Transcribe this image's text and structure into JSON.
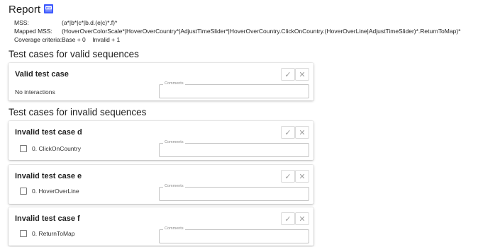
{
  "report": {
    "title": "Report",
    "pdf_icon_label": "PDF"
  },
  "meta": {
    "mss_label": "MSS:",
    "mss_value": "(a*|b*|c*|b.d.(e|c)*.f)*",
    "mapped_label": "Mapped MSS:",
    "mapped_value": "(HoverOverColorScale*|HoverOverCountry*|AdjustTimeSlider*|HoverOverCountry.ClickOnCountry.(HoverOverLine|AdjustTimeSlider)*.ReturnToMap)*",
    "coverage_label": "Coverage criteria:",
    "coverage_base": "Base + 0",
    "coverage_invalid": "Invalid + 1"
  },
  "valid_section": {
    "title": "Test cases for valid sequences",
    "cards": [
      {
        "title": "Valid test case",
        "body_text": "No interactions",
        "comment_label": "Comments"
      }
    ]
  },
  "invalid_section": {
    "title": "Test cases for invalid sequences",
    "cards": [
      {
        "title": "Invalid test case d",
        "step": "0. ClickOnCountry",
        "comment_label": "Comments"
      },
      {
        "title": "Invalid test case e",
        "step": "0. HoverOverLine",
        "comment_label": "Comments"
      },
      {
        "title": "Invalid test case f",
        "step": "0. ReturnToMap",
        "comment_label": "Comments"
      }
    ]
  },
  "icons": {
    "confirm": "check-icon",
    "reject": "close-icon",
    "export": "pdf-icon"
  },
  "colors": {
    "pdf_icon": "#3d5afe",
    "button_icon": "#9e9e9e",
    "border": "#c4c4c4"
  }
}
